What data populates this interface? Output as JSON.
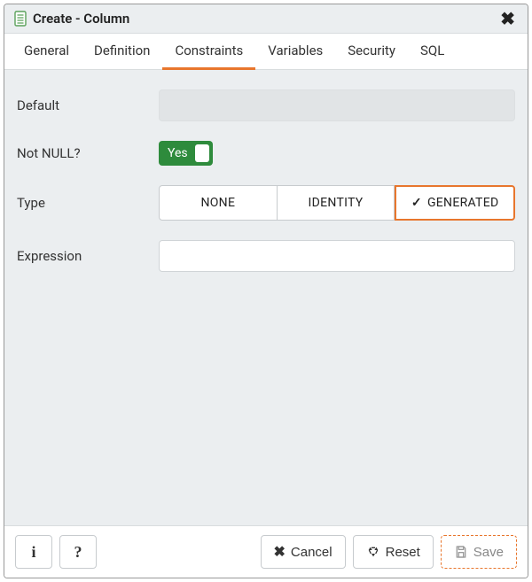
{
  "title": "Create - Column",
  "tabs": [
    {
      "label": "General",
      "active": false
    },
    {
      "label": "Definition",
      "active": false
    },
    {
      "label": "Constraints",
      "active": true
    },
    {
      "label": "Variables",
      "active": false
    },
    {
      "label": "Security",
      "active": false
    },
    {
      "label": "SQL",
      "active": false
    }
  ],
  "form": {
    "default_label": "Default",
    "default_value": "",
    "notnull_label": "Not NULL?",
    "notnull_text": "Yes",
    "notnull_on": true,
    "type_label": "Type",
    "type_options": [
      {
        "label": "NONE",
        "selected": false
      },
      {
        "label": "IDENTITY",
        "selected": false
      },
      {
        "label": "GENERATED",
        "selected": true
      }
    ],
    "expression_label": "Expression",
    "expression_value": ""
  },
  "footer": {
    "info_tip": "i",
    "help_tip": "?",
    "cancel": "Cancel",
    "reset": "Reset",
    "save": "Save"
  }
}
